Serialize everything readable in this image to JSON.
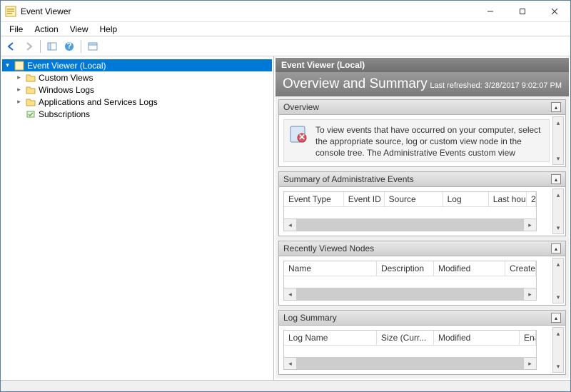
{
  "window": {
    "title": "Event Viewer"
  },
  "menu": {
    "file": "File",
    "action": "Action",
    "view": "View",
    "help": "Help"
  },
  "tree": {
    "root": "Event Viewer (Local)",
    "items": [
      "Custom Views",
      "Windows Logs",
      "Applications and Services Logs",
      "Subscriptions"
    ]
  },
  "panel": {
    "header": "Event Viewer (Local)",
    "title": "Overview and Summary",
    "refreshed": "Last refreshed: 3/28/2017 9:02:07 PM"
  },
  "sections": {
    "overview": {
      "title": "Overview",
      "text": "To view events that have occurred on your computer, select the appropriate source, log or custom view node in the console tree. The Administrative Events custom view contains all the administrative events, regardless of"
    },
    "summary": {
      "title": "Summary of Administrative Events",
      "cols": [
        "Event Type",
        "Event ID",
        "Source",
        "Log",
        "Last hour",
        "2"
      ]
    },
    "recent": {
      "title": "Recently Viewed Nodes",
      "cols": [
        "Name",
        "Description",
        "Modified",
        "Created"
      ]
    },
    "logsum": {
      "title": "Log Summary",
      "cols": [
        "Log Name",
        "Size (Curr...",
        "Modified",
        "Enabled"
      ]
    }
  }
}
